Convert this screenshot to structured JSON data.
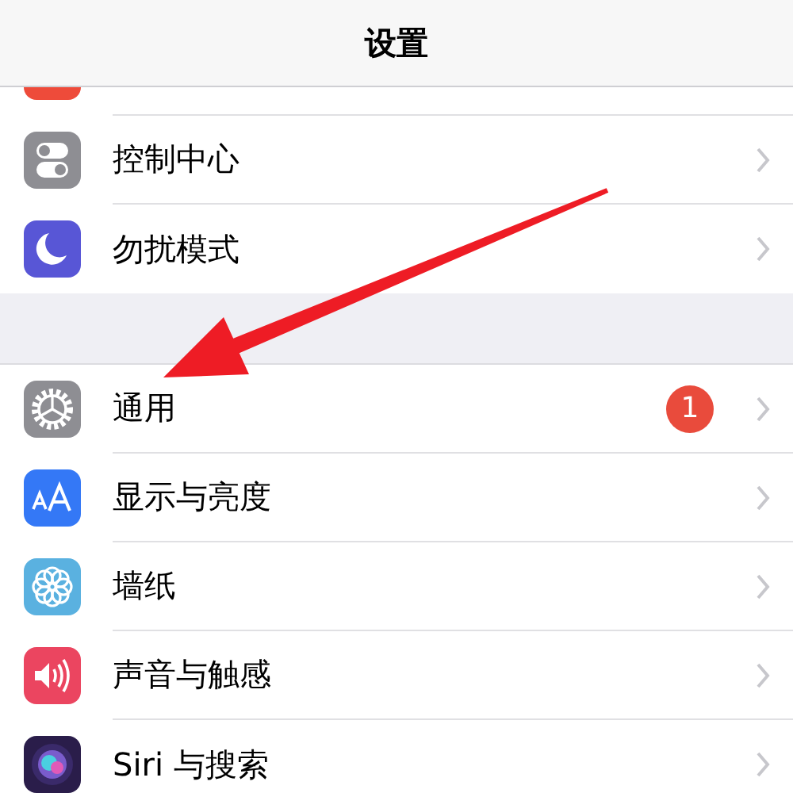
{
  "nav": {
    "title": "设置"
  },
  "sections": [
    {
      "items": [
        {
          "kind": "notifications"
        },
        {
          "kind": "control",
          "label": "控制中心"
        },
        {
          "kind": "moon",
          "label": "勿扰模式"
        }
      ]
    },
    {
      "items": [
        {
          "kind": "gear",
          "label": "通用",
          "badge": "1"
        },
        {
          "kind": "display",
          "label": "显示与亮度"
        },
        {
          "kind": "wallpaper",
          "label": "墙纸"
        },
        {
          "kind": "sound",
          "label": "声音与触感"
        },
        {
          "kind": "siri",
          "label": "Siri 与搜索"
        }
      ]
    }
  ]
}
